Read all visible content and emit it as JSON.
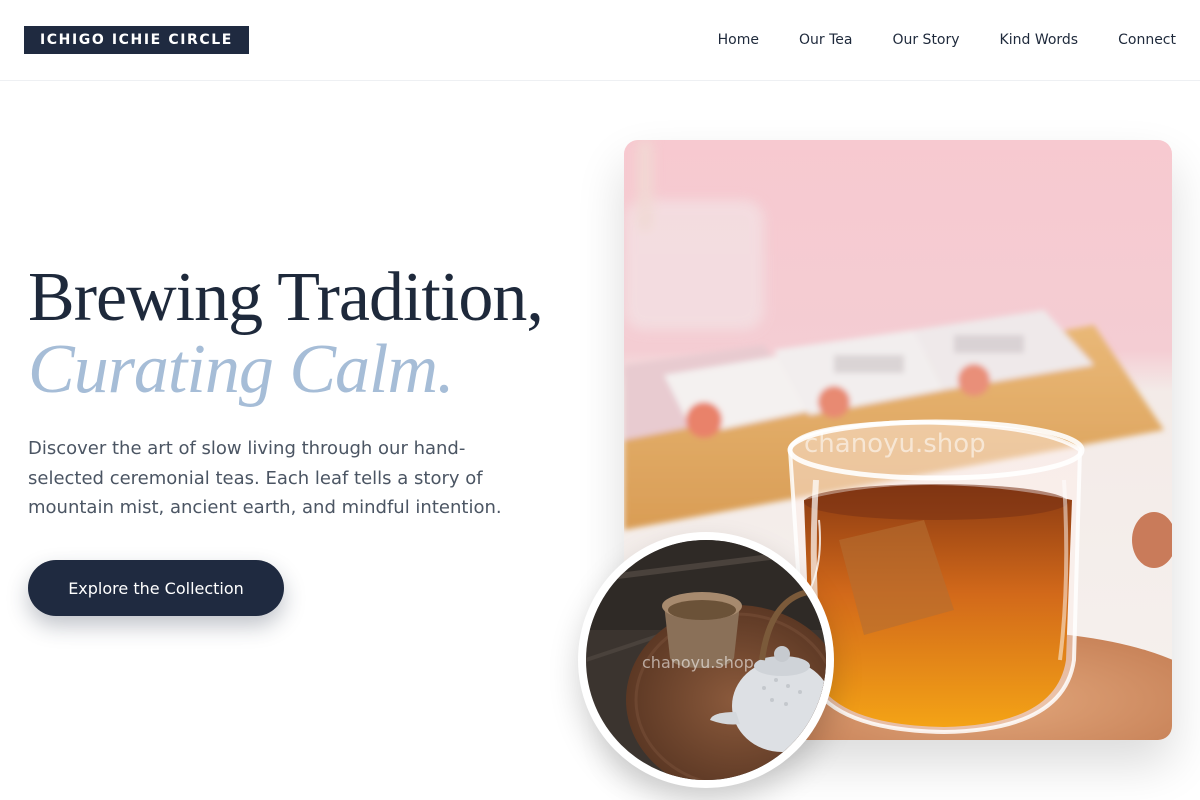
{
  "header": {
    "brand": "ICHIGO ICHIE CIRCLE",
    "nav": [
      {
        "label": "Home"
      },
      {
        "label": "Our Tea"
      },
      {
        "label": "Our Story"
      },
      {
        "label": "Kind Words"
      },
      {
        "label": "Connect"
      }
    ]
  },
  "hero": {
    "headline_line1": "Brewing Tradition,",
    "headline_line2": "Curating Calm.",
    "description": "Discover the art of slow living through our hand-selected ceremonial teas. Each leaf tells a story of mountain mist, ancient earth, and mindful intention.",
    "cta_label": "Explore the Collection"
  },
  "images": {
    "main_watermark": "chanoyu.shop",
    "round_watermark": "chanoyu.shop"
  },
  "colors": {
    "navy": "#1f2a40",
    "accent_blue": "#a6bdd7",
    "body_text": "#4b5563"
  }
}
